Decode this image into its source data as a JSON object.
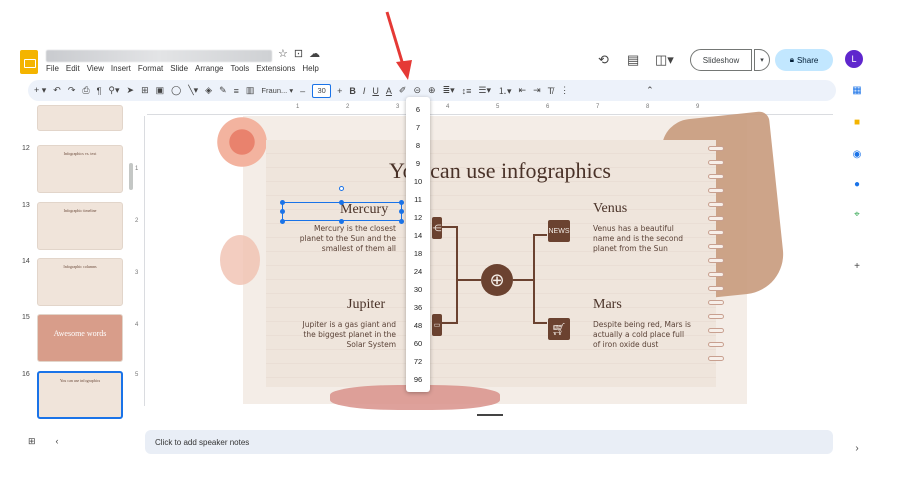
{
  "header": {
    "menus": [
      "File",
      "Edit",
      "View",
      "Insert",
      "Format",
      "Slide",
      "Arrange",
      "Tools",
      "Extensions",
      "Help"
    ],
    "slideshow_label": "Slideshow",
    "share_label": "Share",
    "avatar_letter": "L"
  },
  "toolbar": {
    "font_name": "Fraun...",
    "font_size": "30"
  },
  "ruler": {
    "h_numbers": [
      "1",
      "2",
      "3",
      "4",
      "5",
      "6",
      "7",
      "8",
      "9"
    ],
    "v_numbers": [
      "1",
      "2",
      "3",
      "4",
      "5"
    ]
  },
  "filmstrip": {
    "slides": [
      {
        "num": "12",
        "title": "Infographics vs. text",
        "big": ""
      },
      {
        "num": "13",
        "title": "Infographic timeline",
        "big": ""
      },
      {
        "num": "14",
        "title": "Infographic columns",
        "big": ""
      },
      {
        "num": "15",
        "title": "",
        "big": "Awesome words"
      },
      {
        "num": "16",
        "title": "You can use infographics",
        "big": ""
      }
    ]
  },
  "slide": {
    "title": "You can use infographics",
    "mercury": {
      "heading": "Mercury",
      "text": [
        "Mercury is the closest",
        "planet to the Sun and the",
        "smallest of them all"
      ]
    },
    "jupiter": {
      "heading": "Jupiter",
      "text": [
        "Jupiter is a gas giant and",
        "the biggest planet in the",
        "Solar System"
      ]
    },
    "venus": {
      "heading": "Venus",
      "text": [
        "Venus has a beautiful",
        "name and is the second",
        "planet from the Sun"
      ]
    },
    "mars": {
      "heading": "Mars",
      "text": [
        "Despite being red, Mars is",
        "actually a cold place full",
        "of iron oxide dust"
      ]
    },
    "news_icon_label": "NEWS"
  },
  "font_size_dropdown": [
    "6",
    "7",
    "8",
    "9",
    "10",
    "11",
    "12",
    "14",
    "18",
    "24",
    "30",
    "36",
    "48",
    "60",
    "72",
    "96"
  ],
  "notes_placeholder": "Click to add speaker notes",
  "colors": {
    "accent": "#1a73e8",
    "arrow": "#e53935",
    "brown": "#6b4230"
  }
}
